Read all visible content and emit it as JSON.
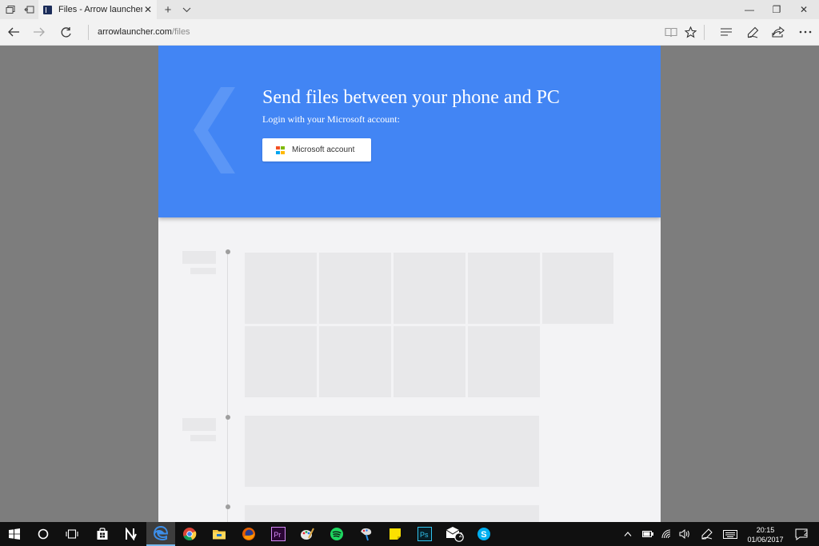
{
  "browser": {
    "tab_title": "Files - Arrow launcher",
    "url_domain": "arrowlauncher.com",
    "url_path": "/files",
    "new_tab_symbol": "+",
    "tab_close_symbol": "✕",
    "window_controls": {
      "minimize": "—",
      "restore": "❐",
      "close": "✕"
    },
    "tab_favicon": "arrow-launcher-icon"
  },
  "hero": {
    "title": "Send files between your phone and PC",
    "subtitle": "Login with your Microsoft account:",
    "button_label": "Microsoft account",
    "background_color": "#4285f4",
    "ms_logo_colors": [
      "#f25022",
      "#7fba00",
      "#00a4ef",
      "#ffb900"
    ]
  },
  "taskbar": {
    "apps": [
      "start-icon",
      "cortana-icon",
      "task-view-icon",
      "store-icon",
      "onenote-icon",
      "edge-icon",
      "chrome-icon",
      "file-explorer-icon",
      "firefox-icon",
      "premiere-icon",
      "paint-icon",
      "spotify-icon",
      "paint-3d-icon",
      "sticky-notes-icon",
      "photoshop-icon",
      "mail-icon",
      "skype-icon"
    ],
    "mail_badge": "2",
    "notification_count": "2",
    "time": "20:15",
    "date": "01/06/2017"
  }
}
